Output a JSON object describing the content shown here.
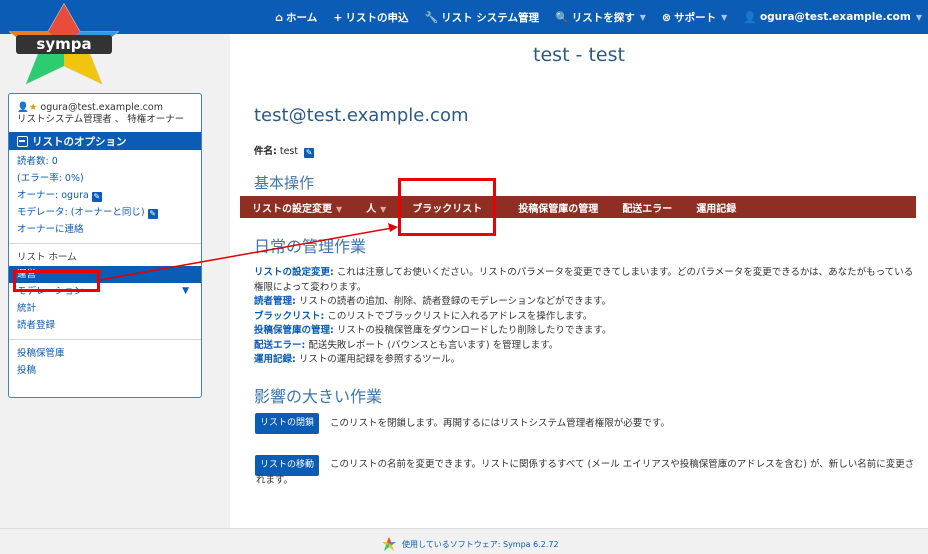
{
  "topnav": {
    "home": "ホーム",
    "request_list": "リストの申込",
    "list_admin": "リスト システム管理",
    "search_list": "リストを探す",
    "support": "サポート",
    "user_email": "ogura@test.example.com"
  },
  "logo": {
    "text": "sympa"
  },
  "list_title": "test - test",
  "sidebar": {
    "user_email": "ogura@test.example.com",
    "user_roles": "リストシステム管理者 、 特権オーナー",
    "options_header": "リストのオプション",
    "subscribers": "読者数: 0",
    "error_rate": "(エラー率: 0%)",
    "owner": "オーナー: ogura",
    "moderator": "モデレータ: (オーナーと同じ)",
    "contact_owner": "オーナーに連絡",
    "list_home": "リスト ホーム",
    "admin": "運営",
    "moderation": "モデレーション",
    "stats": "統計",
    "subscribe": "読者登録",
    "archive": "投稿保管庫",
    "post": "投稿"
  },
  "main": {
    "email_heading": "test@test.example.com",
    "subject_label": "件名:",
    "subject_value": "test",
    "basic_ops": "基本操作",
    "menu": {
      "list_settings": "リストの設定変更",
      "people": "人",
      "blacklist": "ブラックリスト",
      "archive_admin": "投稿保管庫の管理",
      "bounces": "配送エラー",
      "logs": "運用記録"
    },
    "daily_heading": "日常の管理作業",
    "desc": {
      "settings_key": "リストの設定変更:",
      "settings_text": " これは注意してお使いください。リストのパラメータを変更できてしまいます。どのパラメータを変更できるかは、あなたがもっている権限によって変わります。",
      "subscribers_key": "読者管理:",
      "subscribers_text": " リストの読者の追加、削除、読者登録のモデレーションなどができます。",
      "blacklist_key": "ブラックリスト:",
      "blacklist_text": " このリストでブラックリストに入れるアドレスを操作します。",
      "archive_key": "投稿保管庫の管理:",
      "archive_text": " リストの投稿保管庫をダウンロードしたり削除したりできます。",
      "bounces_key": "配送エラー:",
      "bounces_text": " 配送失敗レポート (バウンスとも言います) を管理します。",
      "logs_key": "運用記録:",
      "logs_text": " リストの運用記録を参照するツール。"
    },
    "impact_heading": "影響の大きい作業",
    "close_button": "リストの閉鎖",
    "close_text": "このリストを閉鎖します。再開するにはリストシステム管理者権限が必要です。",
    "rename_button": "リストの移動",
    "rename_text": "このリストの名前を変更できます。リストに関係するすべて (メール エイリアスや投稿保管庫のアドレスを含む) が、新しい名前に変更されます。"
  },
  "footer": {
    "text": "使用しているソフトウェア: Sympa 6.2.72"
  },
  "colors": {
    "primary": "#0b5cb4",
    "menu_bar": "#8f2f24",
    "annotation": "#e00000"
  }
}
